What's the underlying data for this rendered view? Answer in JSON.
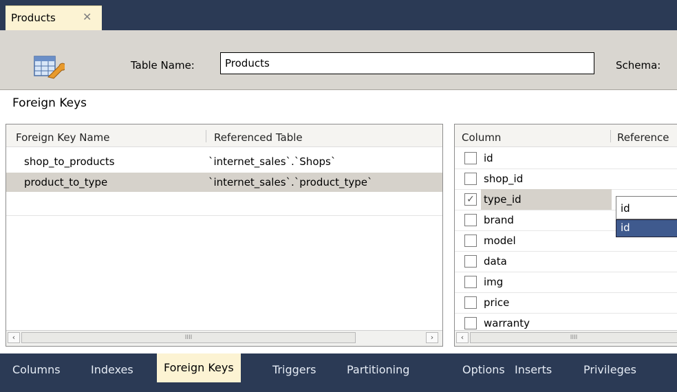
{
  "doc_tab": {
    "label": "Products",
    "close": "✕"
  },
  "header": {
    "table_name_label": "Table Name:",
    "table_name_value": "Products",
    "schema_label": "Schema:"
  },
  "section_title": "Foreign Keys",
  "fk_grid": {
    "headers": [
      "Foreign Key Name",
      "Referenced Table"
    ],
    "rows": [
      {
        "name": "shop_to_products",
        "table": "`internet_sales`.`Shops`",
        "selected": false
      },
      {
        "name": "product_to_type",
        "table": "`internet_sales`.`product_type`",
        "selected": true
      }
    ]
  },
  "col_grid": {
    "headers": [
      "Column",
      "Reference"
    ],
    "rows": [
      {
        "name": "id",
        "checked": false
      },
      {
        "name": "shop_id",
        "checked": false
      },
      {
        "name": "type_id",
        "checked": true
      },
      {
        "name": "brand",
        "checked": false
      },
      {
        "name": "model",
        "checked": false
      },
      {
        "name": "data",
        "checked": false
      },
      {
        "name": "img",
        "checked": false
      },
      {
        "name": "price",
        "checked": false
      },
      {
        "name": "warranty",
        "checked": false
      }
    ],
    "combo_value": "id",
    "combo_option": "id"
  },
  "scrollbar": {
    "left_arrow": "‹",
    "right_arrow": "›",
    "grip": "IIII"
  },
  "bottom_tabs": [
    {
      "label": "Columns"
    },
    {
      "label": "Indexes"
    },
    {
      "label": "Foreign Keys"
    },
    {
      "label": "Triggers"
    },
    {
      "label": "Partitioning"
    },
    {
      "label": "Options"
    },
    {
      "label": "Inserts"
    },
    {
      "label": "Privileges"
    }
  ],
  "active_bottom_tab": "Foreign Keys",
  "colors": {
    "tab_bar": "#2b3a55",
    "active_tab": "#fcf3d3",
    "header_bg": "#d9d6d0",
    "selection": "#d6d2cb",
    "dropdown_highlight": "#3f5a8e"
  },
  "icons": {
    "table_editor": "table-wrench-icon",
    "close": "close-icon",
    "checkbox": "checkbox"
  }
}
